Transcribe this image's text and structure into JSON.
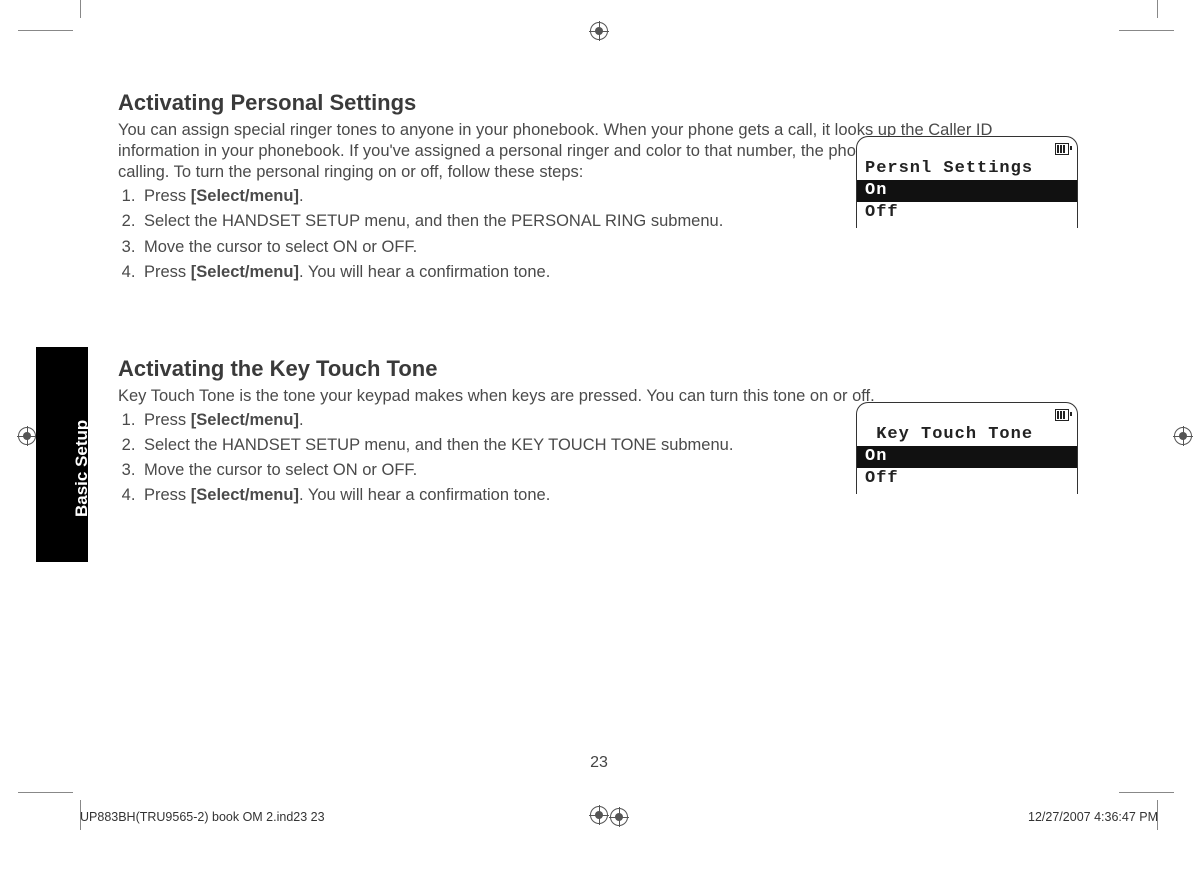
{
  "side_tab": "Basic Setup",
  "page_number": "23",
  "footer": {
    "left": "UP883BH(TRU9565-2) book OM 2.ind23   23",
    "right": "12/27/2007   4:36:47 PM"
  },
  "sections": [
    {
      "heading": "Activating Personal Settings",
      "intro": "You can assign special ringer tones to anyone in your phonebook. When your phone gets a call, it looks up the Caller ID information in your phonebook. If you've assigned a personal ringer and color to that number, the phone uses it so you know who is calling. To turn the personal ringing on or off, follow these steps:",
      "steps": [
        {
          "pre": "Press ",
          "bold": "[Select/menu]",
          "post": "."
        },
        {
          "pre": "Select the HANDSET SETUP menu, and then the PERSONAL RING submenu.",
          "bold": "",
          "post": ""
        },
        {
          "pre": "Move the cursor to select ON or OFF.",
          "bold": "",
          "post": ""
        },
        {
          "pre": "Press ",
          "bold": "[Select/menu]",
          "post": ". You will hear a confirmation tone."
        }
      ],
      "lcd": {
        "title": "Persnl Settings",
        "selected": "On",
        "other": "Off"
      }
    },
    {
      "heading": "Activating the Key Touch Tone",
      "intro": "Key Touch Tone is the tone your keypad makes when keys are pressed. You can turn this tone on or off.",
      "steps": [
        {
          "pre": "Press ",
          "bold": "[Select/menu]",
          "post": "."
        },
        {
          "pre": "Select the HANDSET SETUP menu, and then the KEY TOUCH TONE submenu.",
          "bold": "",
          "post": ""
        },
        {
          "pre": "Move the cursor to select ON or OFF.",
          "bold": "",
          "post": ""
        },
        {
          "pre": "Press ",
          "bold": "[Select/menu]",
          "post": ". You will hear a confirmation tone."
        }
      ],
      "lcd": {
        "title": " Key Touch Tone",
        "selected": "On",
        "other": "Off"
      }
    }
  ]
}
